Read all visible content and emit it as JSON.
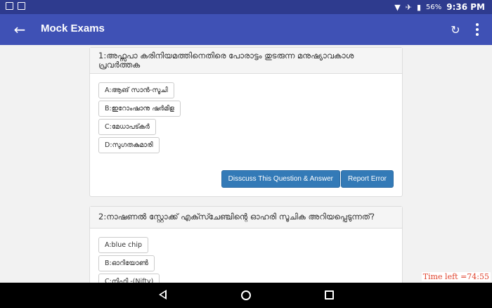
{
  "statusbar": {
    "battery_percent": "56%",
    "time": "9:36 PM"
  },
  "appbar": {
    "title": "Mock Exams",
    "back_icon": "arrow-left-icon",
    "refresh_icon": "refresh-icon",
    "menu_icon": "more-vert-icon"
  },
  "questions": [
    {
      "text": "1:അഫ്സപാ കരിനിയമത്തിനെതിരെ പോരാട്ടം തുടരുന്ന മനുഷ്യാവകാശ പ്രവർത്തക",
      "options": [
        "A:ആങ് സാൻ-സൂചി",
        "B:ഇറോംഷാനു ഷർമിള",
        "C:മേധാപട്കർ",
        "D:സുഗതകുമാരി"
      ],
      "discuss_label": "Disscuss This Question & Answer",
      "report_label": "Report Error"
    },
    {
      "text": "2:നാഷണൽ സ്റ്റോക്ക് എക്സ്ചേഞ്ചിന്റെ ഓഹരി സൂചിക അറിയപ്പെടുന്നത്?",
      "options": [
        "A:blue chip",
        "B:ഓറിയോൺ",
        "C:നിഫ്റ്റി -(Nifty)"
      ]
    }
  ],
  "timer": {
    "text": "Time left =74:55"
  },
  "colors": {
    "statusbar": "#2e3b8e",
    "appbar": "#3f51b5",
    "button": "#337ab7",
    "timer": "#e0452f"
  }
}
